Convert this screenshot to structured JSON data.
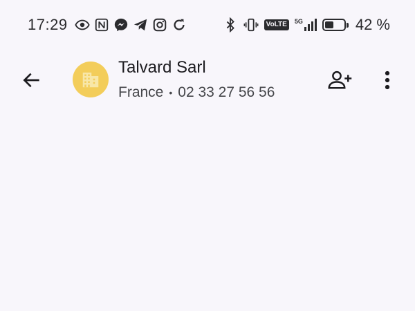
{
  "status_bar": {
    "time": "17:29",
    "left_icons": [
      "eye-icon",
      "nfc-icon",
      "messenger-icon",
      "telegram-icon",
      "instagram-icon",
      "sync-icon"
    ],
    "right_icons": [
      "bluetooth-icon",
      "vibrate-icon",
      "volte-icon",
      "5g-signal-icon",
      "battery-icon"
    ],
    "volte_label": "VoLTE",
    "network_label": "5G",
    "battery_level": 0.42,
    "battery_text": "42 %"
  },
  "contact": {
    "name": "Talvard Sarl",
    "country": "France",
    "separator": "•",
    "phone": "02 33 27 56 56",
    "avatar_icon": "building-icon",
    "avatar_color": "#f3cd5a"
  },
  "actions": {
    "back_icon": "arrow-back-icon",
    "add_contact_icon": "person-add-icon",
    "more_icon": "more-vert-icon"
  }
}
